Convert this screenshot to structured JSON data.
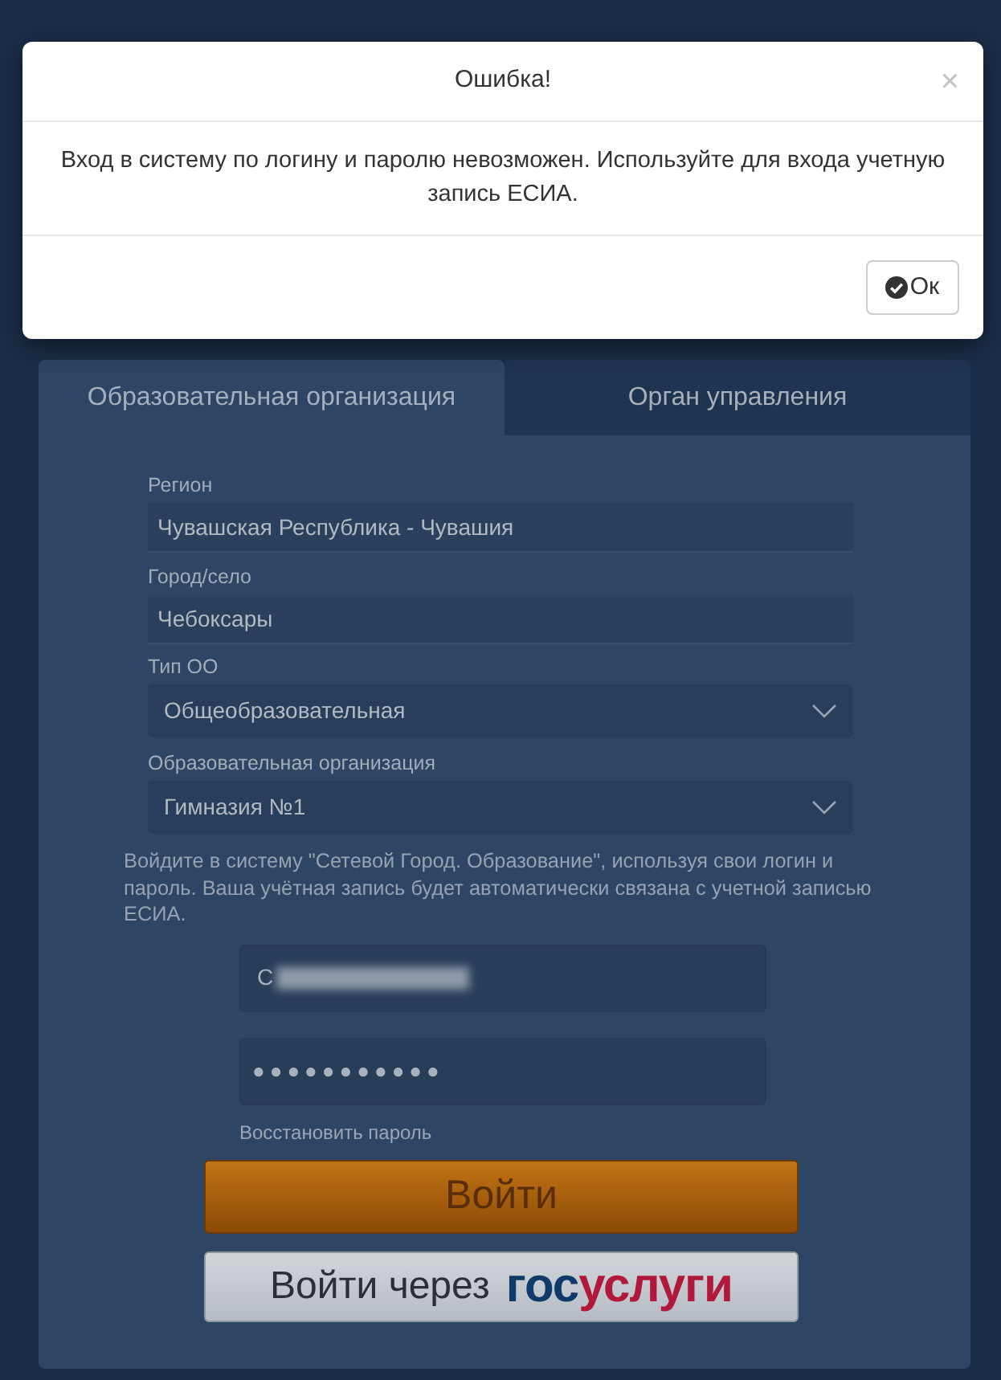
{
  "dialog": {
    "title": "Ошибка!",
    "close": "×",
    "message": "Вход в систему по логину и паролю невозможен. Используйте для входа учетную запись ЕСИА.",
    "ok_button": "Ок"
  },
  "tabs": [
    {
      "label": "Образовательная организация",
      "selected": true
    },
    {
      "label": "Орган управления",
      "selected": false
    }
  ],
  "form": {
    "fields": [
      {
        "label": "Регион",
        "value": "Чувашская Республика - Чувашия",
        "kind": "text"
      },
      {
        "label": "Город/село",
        "value": "Чебоксары",
        "kind": "text"
      },
      {
        "label": "Тип ОО",
        "value": "Общеобразовательная",
        "kind": "select"
      },
      {
        "label": "Образовательная организация",
        "value": "Гимназия №1",
        "kind": "select"
      }
    ],
    "notice": "Войдите в систему \"Сетевой Город. Образование\", используя свои логин и пароль. Ваша учётная запись будет автоматически связана с учетной записью ЕСИА.",
    "login": {
      "value": "С",
      "blurred": true
    },
    "password": {
      "value": "●●●●●●●●●●●"
    },
    "forgot_link": "Восстановить пароль",
    "login_button": "Войти",
    "gosuslugi_button": {
      "label": "Войти через",
      "logo": [
        "гос",
        "услуги"
      ]
    }
  }
}
